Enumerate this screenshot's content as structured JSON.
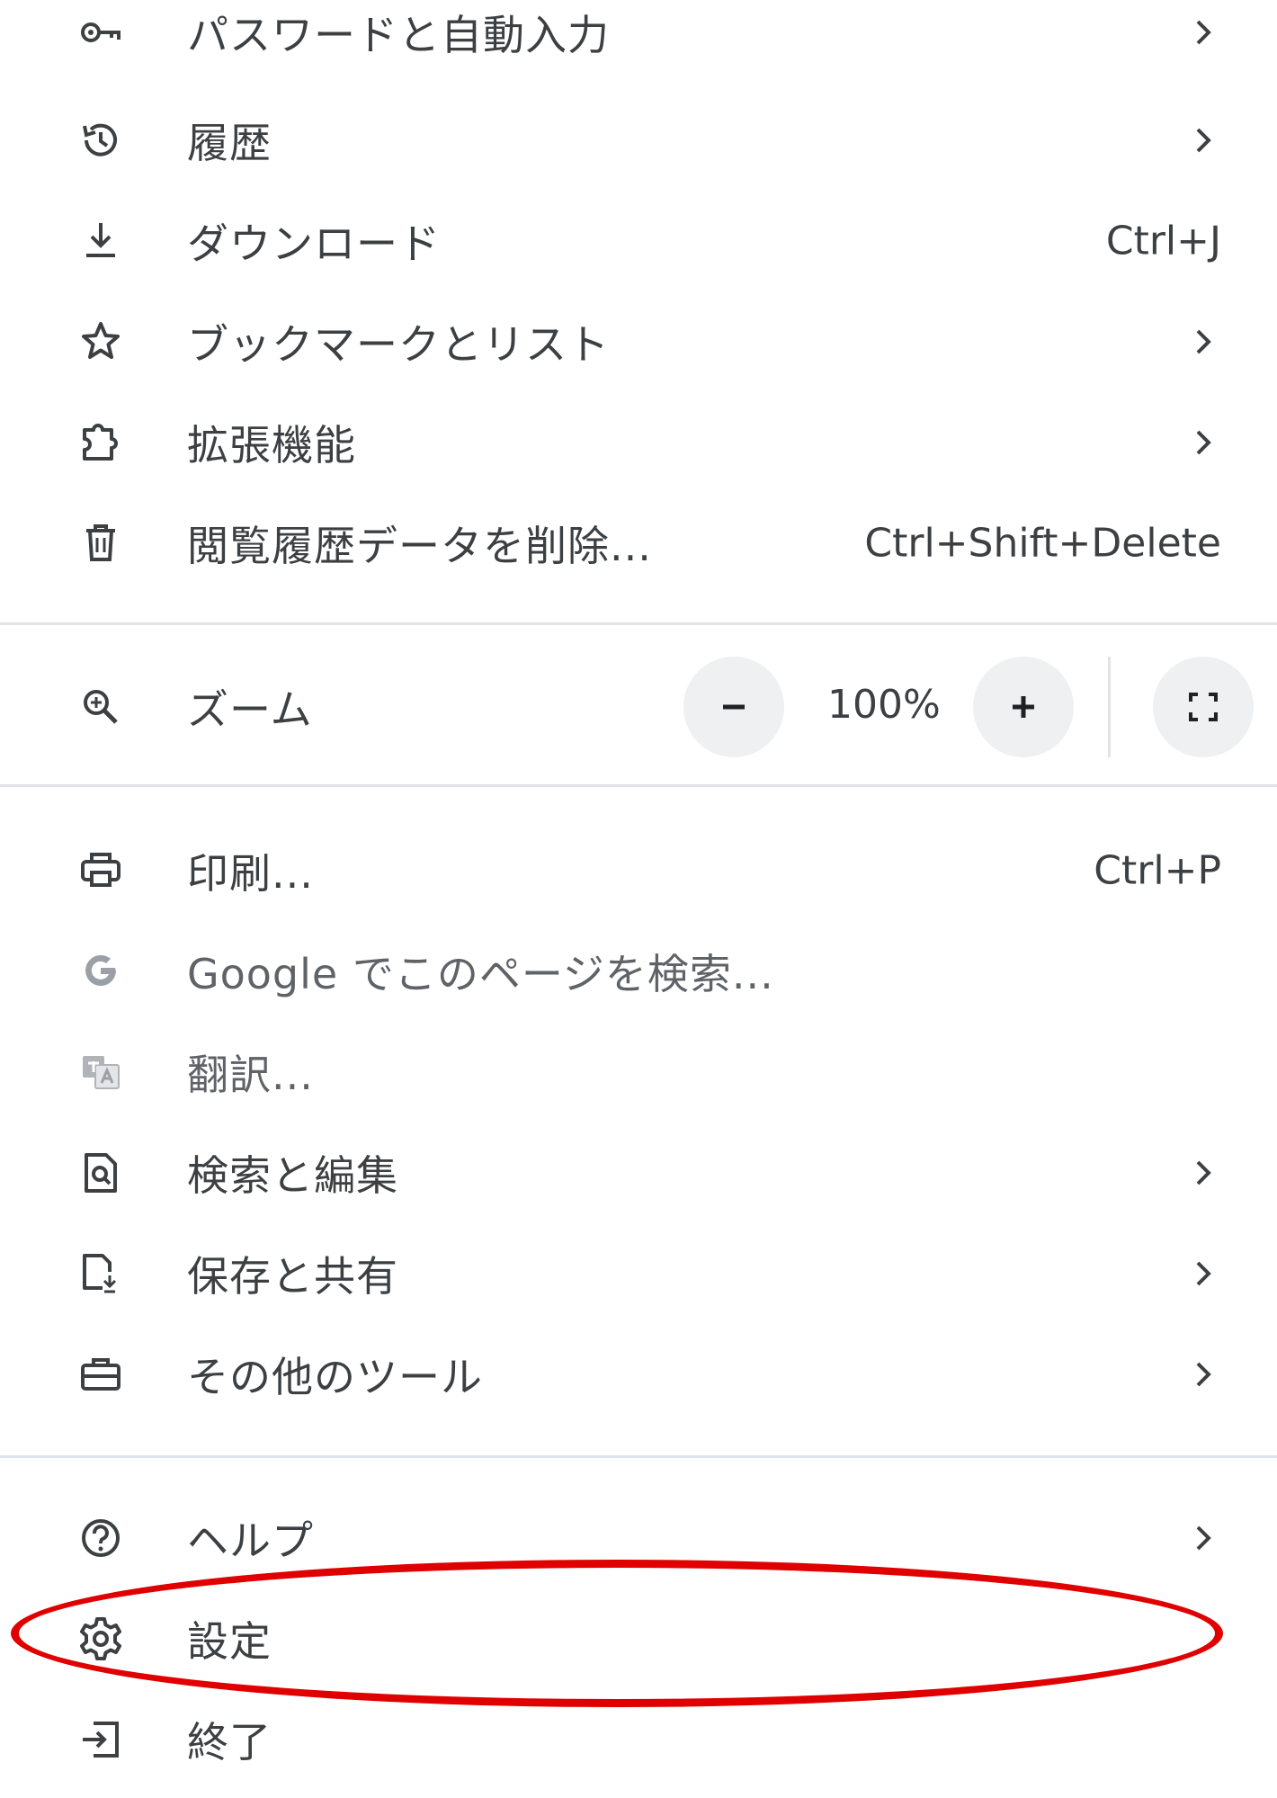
{
  "menu": {
    "items": [
      {
        "id": "passwords",
        "label": "パスワードと自動入力",
        "icon": "key-icon",
        "submenu": true
      },
      {
        "id": "history",
        "label": "履歴",
        "icon": "history-icon",
        "submenu": true
      },
      {
        "id": "downloads",
        "label": "ダウンロード",
        "icon": "download-icon",
        "shortcut": "Ctrl+J"
      },
      {
        "id": "bookmarks",
        "label": "ブックマークとリスト",
        "icon": "star-icon",
        "submenu": true
      },
      {
        "id": "extensions",
        "label": "拡張機能",
        "icon": "puzzle-icon",
        "submenu": true
      },
      {
        "id": "clear-data",
        "label": "閲覧履歴データを削除...",
        "icon": "trash-icon",
        "shortcut": "Ctrl+Shift+Delete"
      }
    ],
    "zoom": {
      "label": "ズーム",
      "icon": "magnifier-icon",
      "value": "100%",
      "minus_icon": "minus-icon",
      "plus_icon": "plus-icon",
      "fullscreen_icon": "fullscreen-icon"
    },
    "items2": [
      {
        "id": "print",
        "label": "印刷...",
        "icon": "printer-icon",
        "shortcut": "Ctrl+P"
      },
      {
        "id": "google-search",
        "label": "Google でこのページを検索...",
        "icon": "google-icon"
      },
      {
        "id": "translate",
        "label": "翻訳...",
        "icon": "translate-icon"
      },
      {
        "id": "find-edit",
        "label": "検索と編集",
        "icon": "find-page-icon",
        "submenu": true
      },
      {
        "id": "save-share",
        "label": "保存と共有",
        "icon": "save-file-icon",
        "submenu": true
      },
      {
        "id": "more-tools",
        "label": "その他のツール",
        "icon": "toolbox-icon",
        "submenu": true
      }
    ],
    "items3": [
      {
        "id": "help",
        "label": "ヘルプ",
        "icon": "help-icon",
        "submenu": true
      },
      {
        "id": "settings",
        "label": "設定",
        "icon": "gear-icon"
      },
      {
        "id": "exit",
        "label": "終了",
        "icon": "exit-icon"
      }
    ],
    "highlight_color": "#e00000"
  }
}
